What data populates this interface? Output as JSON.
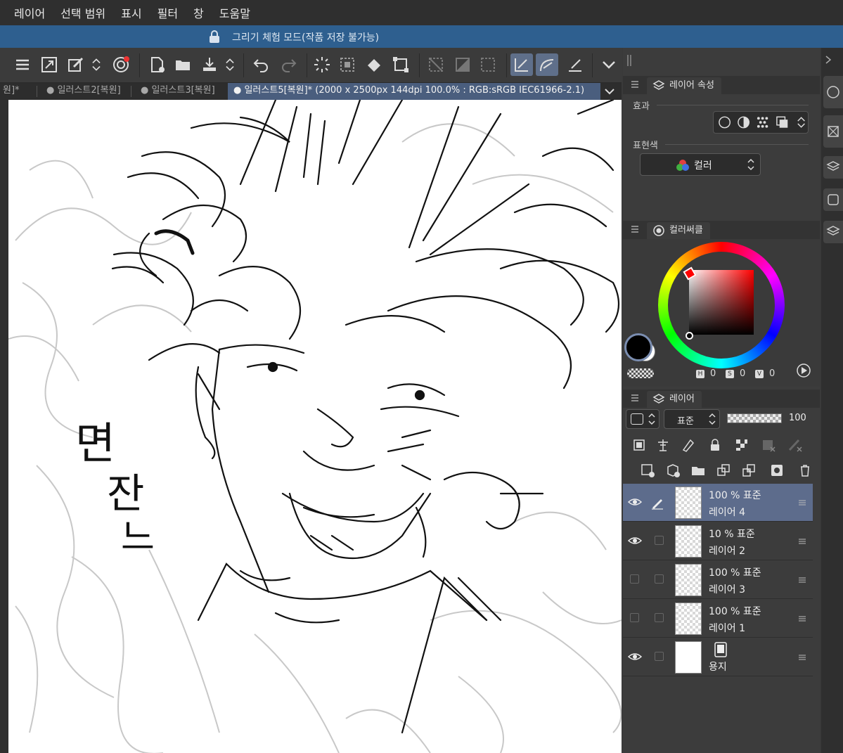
{
  "menu": [
    "레이어",
    "선택 범위",
    "표시",
    "필터",
    "창",
    "도움말"
  ],
  "banner": {
    "text": "그리기 체험 모드(작품 저장 불가능)"
  },
  "tabs": [
    {
      "label": "원]*"
    },
    {
      "label": "● 일러스트2[복원]"
    },
    {
      "label": "● 일러스트3[복원]"
    },
    {
      "label": "● 일러스트5[복원]* (2000 x 2500px 144dpi 100.0% : RGB:sRGB IEC61966-2.1)"
    }
  ],
  "layer_property": {
    "tab_label": "레이어 속성",
    "effect_label": "효과",
    "expression_color_label": "표현색",
    "expression_color_value": "컬러"
  },
  "color_circle": {
    "tab_label": "컬러써클",
    "main_color": "#000000",
    "sub_color": "#ffffff",
    "hue_marker_color": "#ff0000",
    "h": "0",
    "s": "0",
    "v": "0"
  },
  "layers_panel": {
    "tab_label": "레이어",
    "blend_mode": "표준",
    "opacity": "100",
    "layers": [
      {
        "opacity": "100 % 표준",
        "name": "레이어 4",
        "visible": true,
        "selected": true
      },
      {
        "opacity": "10 % 표준",
        "name": "레이어 2",
        "visible": true,
        "selected": false
      },
      {
        "opacity": "100 % 표준",
        "name": "레이어 3",
        "visible": false,
        "selected": false
      },
      {
        "opacity": "100 % 표준",
        "name": "레이어 1",
        "visible": false,
        "selected": false
      },
      {
        "opacity": "",
        "name": "용지",
        "visible": true,
        "selected": false
      }
    ]
  },
  "canvas": {
    "handwriting_lines": [
      "면",
      "잔",
      "느"
    ]
  }
}
